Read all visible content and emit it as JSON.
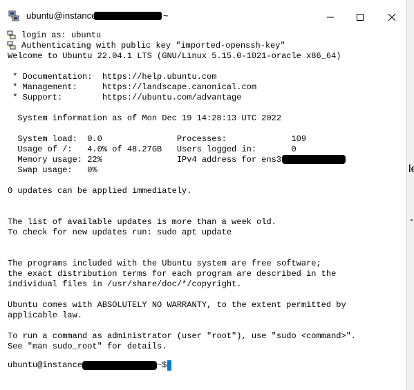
{
  "window": {
    "title_prefix": "ubuntu@instance",
    "title_suffix": "~",
    "buttons": {
      "minimize": "minimize",
      "maximize": "maximize",
      "close": "close"
    }
  },
  "terminal": {
    "login_line": "login as: ubuntu",
    "auth_line": "Authenticating with public key \"imported-openssh-key\"",
    "welcome_line": "Welcome to Ubuntu 22.04.1 LTS (GNU/Linux 5.15.0-1021-oracle x86_64)",
    "doc_line": " * Documentation:  https://help.ubuntu.com",
    "mgmt_line": " * Management:     https://landscape.canonical.com",
    "support_line": " * Support:        https://ubuntu.com/advantage",
    "sysinfo_line": "  System information as of Mon Dec 19 14:28:13 UTC 2022",
    "stats": {
      "load_line": "  System load:  0.0               Processes:             109",
      "usage_line": "  Usage of /:   4.0% of 48.27GB   Users logged in:       0",
      "memory_line": "  Memory usage: 22%               IPv4 address for ens3:",
      "swap_line": "  Swap usage:   0%"
    },
    "updates_line": "0 updates can be applied immediately.",
    "old_list_line": "The list of available updates is more than a week old.",
    "check_line": "To check for new updates run: sudo apt update",
    "free_sw_1": "The programs included with the Ubuntu system are free software;",
    "free_sw_2": "the exact distribution terms for each program are described in the",
    "free_sw_3": "individual files in /usr/share/doc/*/copyright.",
    "warranty_1": "Ubuntu comes with ABSOLUTELY NO WARRANTY, to the extent permitted by",
    "warranty_2": "applicable law.",
    "admin_1": "To run a command as administrator (user \"root\"), use \"sudo <command>\".",
    "admin_2": "See \"man sudo_root\" for details.",
    "prompt_prefix": "ubuntu@instance",
    "prompt_suffix": "~$"
  },
  "background_fragment": "le",
  "colors": {
    "cursor": "#0078d7",
    "redaction": "#000000"
  },
  "icons": {
    "app": "putty-icon",
    "session": "key-icon"
  }
}
